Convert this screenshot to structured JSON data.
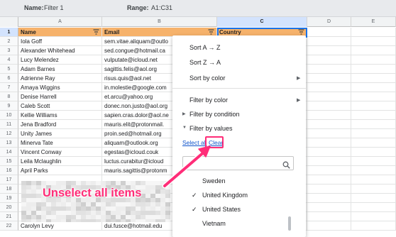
{
  "filter_bar": {
    "name_label": "Name:",
    "name_value": "Filter 1",
    "range_label": "Range:",
    "range_value": "A1:C31"
  },
  "columns": [
    "A",
    "B",
    "C",
    "D",
    "E"
  ],
  "rows": [
    {
      "num": "1",
      "name": "Name",
      "email": "Email",
      "country": "Country"
    },
    {
      "num": "2",
      "name": "Iola Goff",
      "email": "sem.vitae.aliquam@outlo",
      "country": ""
    },
    {
      "num": "3",
      "name": "Alexander Whitehead",
      "email": "sed.congue@hotmail.ca",
      "country": ""
    },
    {
      "num": "4",
      "name": "Lucy Melendez",
      "email": "vulputate@icloud.net",
      "country": ""
    },
    {
      "num": "5",
      "name": "Adam Barnes",
      "email": "sagittis.felis@aol.org",
      "country": ""
    },
    {
      "num": "6",
      "name": "Adrienne Ray",
      "email": "risus.quis@aol.net",
      "country": ""
    },
    {
      "num": "7",
      "name": "Amaya Wiggins",
      "email": "in.molestie@google.com",
      "country": ""
    },
    {
      "num": "8",
      "name": "Denise Harrell",
      "email": "et.arcu@yahoo.org",
      "country": ""
    },
    {
      "num": "9",
      "name": "Caleb Scott",
      "email": "donec.non.justo@aol.org",
      "country": ""
    },
    {
      "num": "10",
      "name": "Kellie Williams",
      "email": "sapien.cras.dolor@aol.ne",
      "country": ""
    },
    {
      "num": "11",
      "name": "Jena Bradford",
      "email": "mauris.elit@protonmail.",
      "country": ""
    },
    {
      "num": "12",
      "name": "Unity James",
      "email": "proin.sed@hotmail.org",
      "country": ""
    },
    {
      "num": "13",
      "name": "Minerva Tate",
      "email": "aliquam@outlook.org",
      "country": ""
    },
    {
      "num": "14",
      "name": "Vincent Conway",
      "email": "egestas@icloud.couk",
      "country": ""
    },
    {
      "num": "15",
      "name": "Leila Mclaughlin",
      "email": "luctus.curabitur@icloud",
      "country": ""
    },
    {
      "num": "16",
      "name": "April Parks",
      "email": "mauris.sagittis@protonm",
      "country": ""
    },
    {
      "num": "17",
      "name": "",
      "email": "",
      "country": ""
    },
    {
      "num": "18",
      "name": "",
      "email": "",
      "country": ""
    },
    {
      "num": "19",
      "name": "",
      "email": "",
      "country": ""
    },
    {
      "num": "20",
      "name": "",
      "email": "",
      "country": ""
    },
    {
      "num": "21",
      "name": "",
      "email": "",
      "country": ""
    },
    {
      "num": "22",
      "name": "Carolyn Levy",
      "email": "dui.fusce@hotmail.edu",
      "country": ""
    }
  ],
  "menu": {
    "sort_az": "Sort A → Z",
    "sort_za": "Sort Z → A",
    "sort_by_color": "Sort by color",
    "filter_by_color": "Filter by color",
    "filter_by_condition": "Filter by condition",
    "filter_by_values": "Filter by values",
    "select_all": "Select all",
    "clear": "Clear",
    "values": [
      {
        "label": "Sweden",
        "checked": false
      },
      {
        "label": "United Kingdom",
        "checked": true
      },
      {
        "label": "United States",
        "checked": true
      },
      {
        "label": "Vietnam",
        "checked": false
      }
    ]
  },
  "annotation": {
    "text": "Unselect all items",
    "color": "#ff2d78"
  },
  "colors": {
    "header_fill": "#f6b26b",
    "selection": "#1a73e8",
    "link": "#1155cc"
  }
}
